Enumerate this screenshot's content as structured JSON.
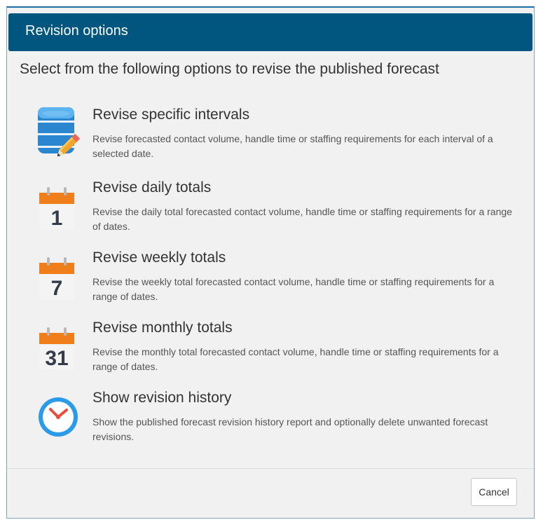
{
  "dialog": {
    "title": "Revision options",
    "subtitle": "Select from the following options to revise the published forecast"
  },
  "options": [
    {
      "title": "Revise specific intervals",
      "description": "Revise forecasted contact volume, handle time or staffing requirements for each interval of a selected date.",
      "icon": "database-edit-icon"
    },
    {
      "title": "Revise daily totals",
      "description": "Revise the daily total forecasted contact volume, handle time or staffing requirements for a range of dates.",
      "icon": "calendar-day-icon",
      "icon_text": "1"
    },
    {
      "title": "Revise weekly totals",
      "description": "Revise the weekly total forecasted contact volume, handle time or staffing requirements for a range of dates.",
      "icon": "calendar-week-icon",
      "icon_text": "7"
    },
    {
      "title": "Revise monthly totals",
      "description": "Revise the monthly total forecasted contact volume, handle time or staffing requirements for a range of dates.",
      "icon": "calendar-month-icon",
      "icon_text": "31"
    },
    {
      "title": "Show revision history",
      "description": "Show the published forecast revision history report and optionally delete unwanted forecast revisions.",
      "icon": "clock-icon"
    }
  ],
  "footer": {
    "cancel_label": "Cancel"
  },
  "colors": {
    "titlebar": "#00567f",
    "calendar_header": "#f07f1b",
    "database_blue": "#2f8fd8",
    "clock_blue": "#2b9ae8",
    "clock_hands": "#e84c3d"
  }
}
